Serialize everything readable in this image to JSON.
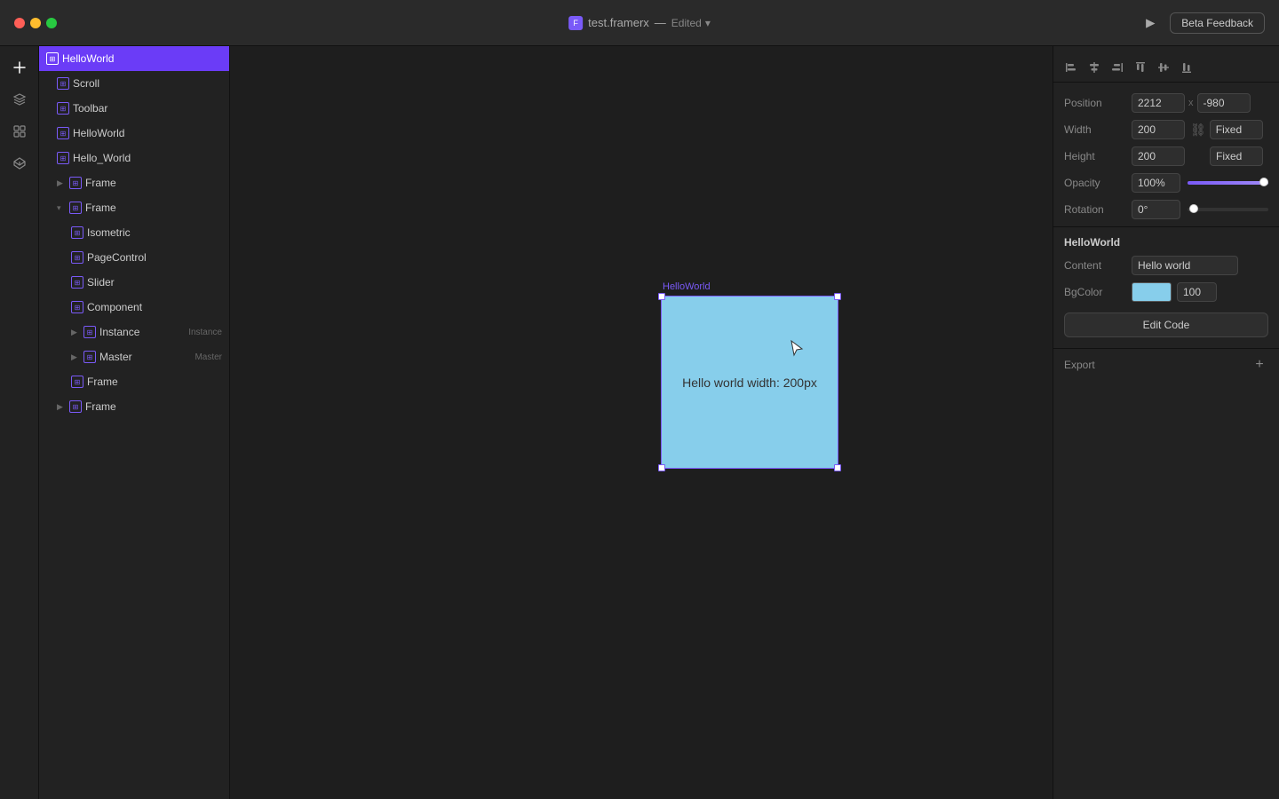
{
  "titlebar": {
    "filename": "test.framerx",
    "separator": "—",
    "status": "Edited",
    "beta_button": "Beta Feedback"
  },
  "layers": [
    {
      "id": "helloworld-root",
      "label": "HelloWorld",
      "indent": 0,
      "selected": true,
      "has_expand": false
    },
    {
      "id": "scroll",
      "label": "Scroll",
      "indent": 1,
      "selected": false,
      "has_expand": false
    },
    {
      "id": "toolbar",
      "label": "Toolbar",
      "indent": 1,
      "selected": false,
      "has_expand": false
    },
    {
      "id": "helloworld-child",
      "label": "HelloWorld",
      "indent": 1,
      "selected": false,
      "has_expand": false
    },
    {
      "id": "hello-world",
      "label": "Hello_World",
      "indent": 1,
      "selected": false,
      "has_expand": false
    },
    {
      "id": "frame1",
      "label": "Frame",
      "indent": 1,
      "selected": false,
      "has_expand": false,
      "expandable": true
    },
    {
      "id": "frame2",
      "label": "Frame",
      "indent": 1,
      "selected": false,
      "has_expand": true,
      "expandable": true
    },
    {
      "id": "isometric",
      "label": "Isometric",
      "indent": 2,
      "selected": false,
      "has_expand": false
    },
    {
      "id": "pagecontrol",
      "label": "PageControl",
      "indent": 2,
      "selected": false,
      "has_expand": false
    },
    {
      "id": "slider",
      "label": "Slider",
      "indent": 2,
      "selected": false,
      "has_expand": false
    },
    {
      "id": "component",
      "label": "Component",
      "indent": 2,
      "selected": false,
      "has_expand": false
    },
    {
      "id": "instance",
      "label": "Instance",
      "indent": 2,
      "selected": false,
      "has_expand": true,
      "badge": "Instance"
    },
    {
      "id": "master",
      "label": "Master",
      "indent": 2,
      "selected": false,
      "has_expand": true,
      "badge": "Master"
    },
    {
      "id": "frame3",
      "label": "Frame",
      "indent": 2,
      "selected": false,
      "has_expand": false
    },
    {
      "id": "frame4",
      "label": "Frame",
      "indent": 1,
      "selected": false,
      "has_expand": true,
      "expandable": true
    }
  ],
  "canvas": {
    "label": "HelloWorld",
    "frame_text": "Hello world width: 200px",
    "frame_bg": "#87CEEB"
  },
  "properties": {
    "position_label": "Position",
    "position_x": "2212",
    "position_x_sep": "x",
    "position_y": "-980",
    "width_label": "Width",
    "width_value": "200",
    "width_mode": "Fixed",
    "height_label": "Height",
    "height_value": "200",
    "height_mode": "Fixed",
    "opacity_label": "Opacity",
    "opacity_value": "100%",
    "rotation_label": "Rotation",
    "rotation_value": "0°",
    "section_title": "HelloWorld",
    "content_label": "Content",
    "content_value": "Hello world",
    "bgcolor_label": "BgColor",
    "bgcolor_hex": "#87CEEB",
    "bgcolor_num": "100",
    "edit_code_label": "Edit Code",
    "export_label": "Export",
    "export_add": "+"
  }
}
